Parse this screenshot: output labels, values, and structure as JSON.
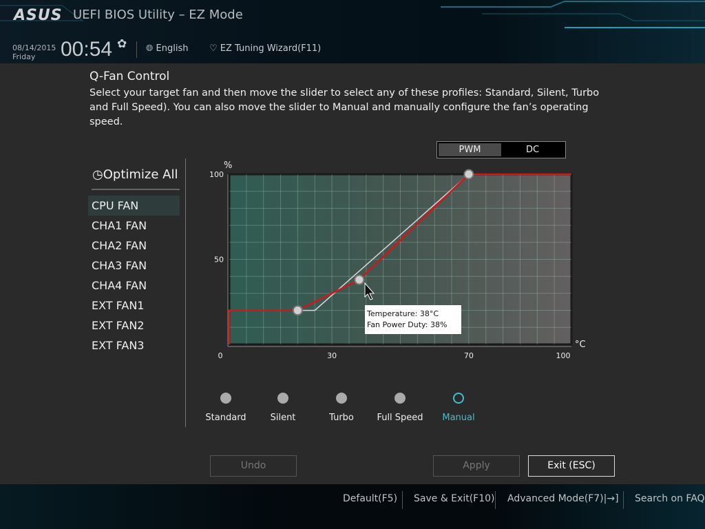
{
  "header": {
    "logo": "ASUS",
    "title": "UEFI BIOS Utility – EZ Mode",
    "date": "08/14/2015",
    "day": "Friday",
    "time": "00:54",
    "language": "English",
    "wizard": "EZ Tuning Wizard(F11)"
  },
  "qfan": {
    "title": "Q-Fan Control",
    "description": "Select your target fan and then move the slider to select any of these profiles: Standard, Silent, Turbo and Full Speed). You can also move the slider to Manual and manually configure the fan’s operating speed."
  },
  "mode_toggle": {
    "options": [
      "PWM",
      "DC"
    ],
    "selected": "PWM"
  },
  "sidebar": {
    "optimize": "Optimize All",
    "fans": [
      "CPU FAN",
      "CHA1 FAN",
      "CHA2 FAN",
      "CHA3 FAN",
      "CHA4 FAN",
      "EXT FAN1",
      "EXT FAN2",
      "EXT FAN3"
    ],
    "selected": "CPU FAN"
  },
  "chart_data": {
    "type": "line",
    "xlabel": "°C",
    "ylabel": "%",
    "xlim": [
      0,
      100
    ],
    "ylim": [
      0,
      100
    ],
    "xticks": [
      "0",
      "30",
      "70",
      "100"
    ],
    "yticks": [
      "100",
      "50"
    ],
    "grid": true,
    "series": [
      {
        "color": "#d01818",
        "points": [
          [
            0,
            0
          ],
          [
            0,
            20
          ],
          [
            20,
            20
          ],
          [
            38,
            38
          ],
          [
            70,
            100
          ],
          [
            100,
            100
          ]
        ]
      },
      {
        "color": "#d8d8d8",
        "points": [
          [
            20,
            20
          ],
          [
            25,
            20
          ],
          [
            70,
            100
          ]
        ]
      }
    ],
    "control_points": [
      [
        20,
        20
      ],
      [
        38,
        38
      ],
      [
        70,
        100
      ]
    ]
  },
  "tooltip": {
    "temperature": "Temperature: 38°C",
    "duty": "Fan Power Duty: 38%"
  },
  "profiles": {
    "options": [
      "Standard",
      "Silent",
      "Turbo",
      "Full Speed",
      "Manual"
    ],
    "selected": "Manual",
    "accent": "#3ec0d0"
  },
  "buttons": {
    "undo": "Undo",
    "apply": "Apply",
    "exit": "Exit (ESC)"
  },
  "footer": {
    "default": "Default(F5)",
    "save": "Save & Exit(F10)",
    "advanced": "Advanced Mode(F7)|→]",
    "faq": "Search on FAQ"
  }
}
